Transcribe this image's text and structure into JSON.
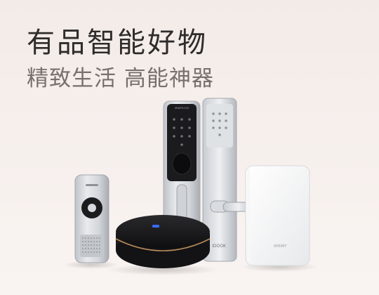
{
  "banner": {
    "headline": "有品智能好物",
    "subline": "精致生活 高能神器"
  },
  "products": {
    "lock_a_brand": "SMARTLOCK",
    "lock_b_brand": "IDOOK",
    "powerbank_brand": "XPRIMT"
  },
  "colors": {
    "background": "#f5eeeb",
    "headline": "#2e2c2b",
    "subline": "#77706c",
    "hub_ring": "#b98a5a",
    "hub_led": "#3a6bff"
  }
}
